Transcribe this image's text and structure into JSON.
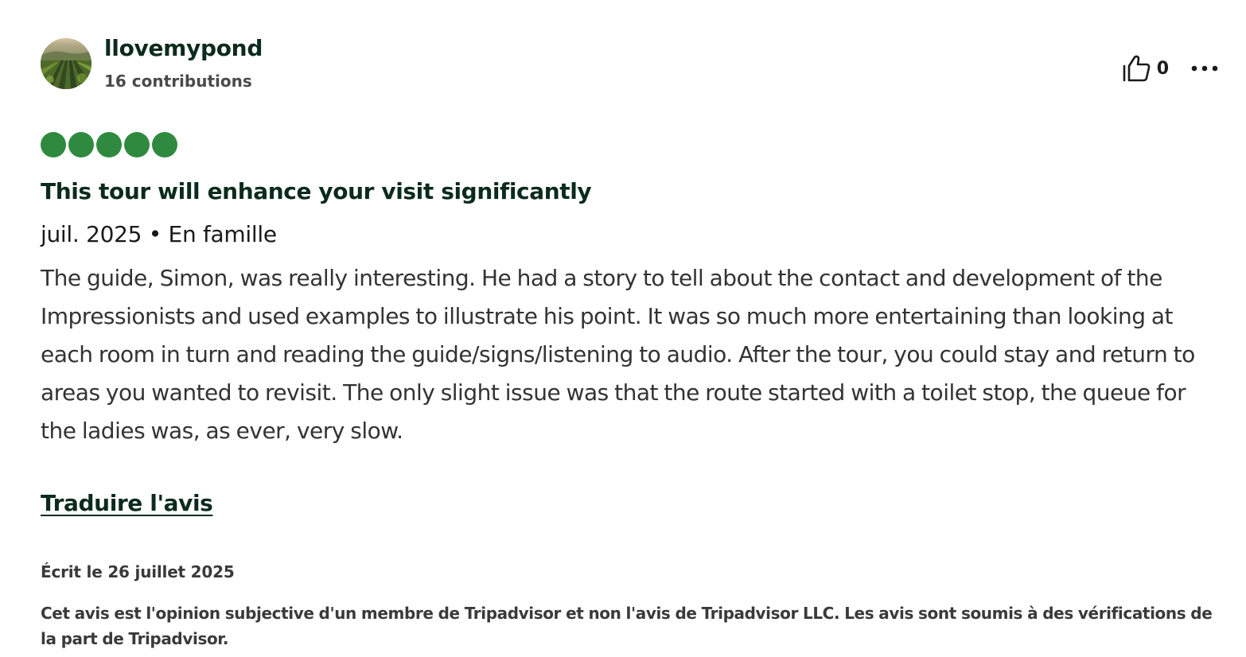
{
  "review": {
    "user": {
      "name": "llovemypond",
      "contributions": "16 contributions",
      "avatar_icon": "vineyard-landscape-photo"
    },
    "actions": {
      "helpful_icon": "thumbs-up-icon",
      "helpful_count": "0",
      "more_icon": "more-options-icon"
    },
    "rating": {
      "value": 5,
      "max": 5,
      "bubble_color": "#2f8a3f"
    },
    "title": "This tour will enhance your visit significantly",
    "meta": "juil. 2025 • En famille",
    "text": "The guide, Simon, was really interesting. He had a story to tell about the contact and development of the Impressionists and used examples to illustrate his point. It was so much more entertaining than looking at each room in turn and reading the guide/signs/listening to audio. After the tour, you could stay and return to areas you wanted to revisit. The only slight issue was that the route started with a toilet stop, the queue for the ladies was, as ever, very slow.",
    "translate_label": "Traduire l'avis",
    "written_date": "Écrit le 26 juillet 2025",
    "disclaimer": "Cet avis est l'opinion subjective d'un membre de Tripadvisor et non l'avis de Tripadvisor LLC. Les avis sont soumis à des vérifications de la part de Tripadvisor."
  }
}
